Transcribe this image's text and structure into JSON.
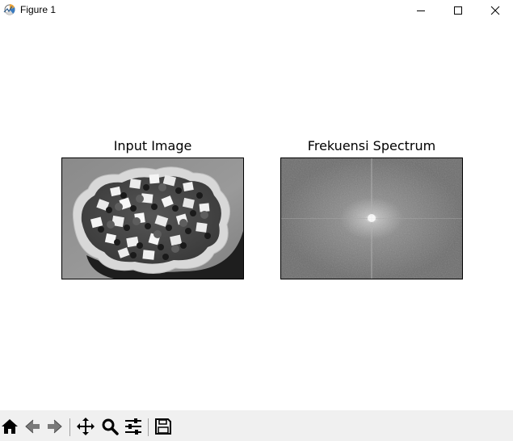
{
  "window": {
    "title": "Figure 1",
    "icons": {
      "app": "matplotlib-figure-icon",
      "minimize": "minimize-icon",
      "maximize": "maximize-icon",
      "close": "close-icon"
    }
  },
  "figure": {
    "subplots": [
      {
        "title": "Input Image",
        "content": "grayscale photo of a bowl of fruit salad"
      },
      {
        "title": "Frekuensi Spectrum",
        "content": "grayscale Fourier magnitude spectrum with bright center"
      }
    ]
  },
  "toolbar": {
    "tools": [
      {
        "name": "home",
        "icon": "home-icon"
      },
      {
        "name": "back",
        "icon": "back-arrow-icon"
      },
      {
        "name": "forward",
        "icon": "forward-arrow-icon"
      },
      {
        "name": "pan",
        "icon": "move-icon"
      },
      {
        "name": "zoom",
        "icon": "zoom-icon"
      },
      {
        "name": "configure-subplots",
        "icon": "sliders-icon"
      },
      {
        "name": "save",
        "icon": "save-icon"
      }
    ]
  }
}
